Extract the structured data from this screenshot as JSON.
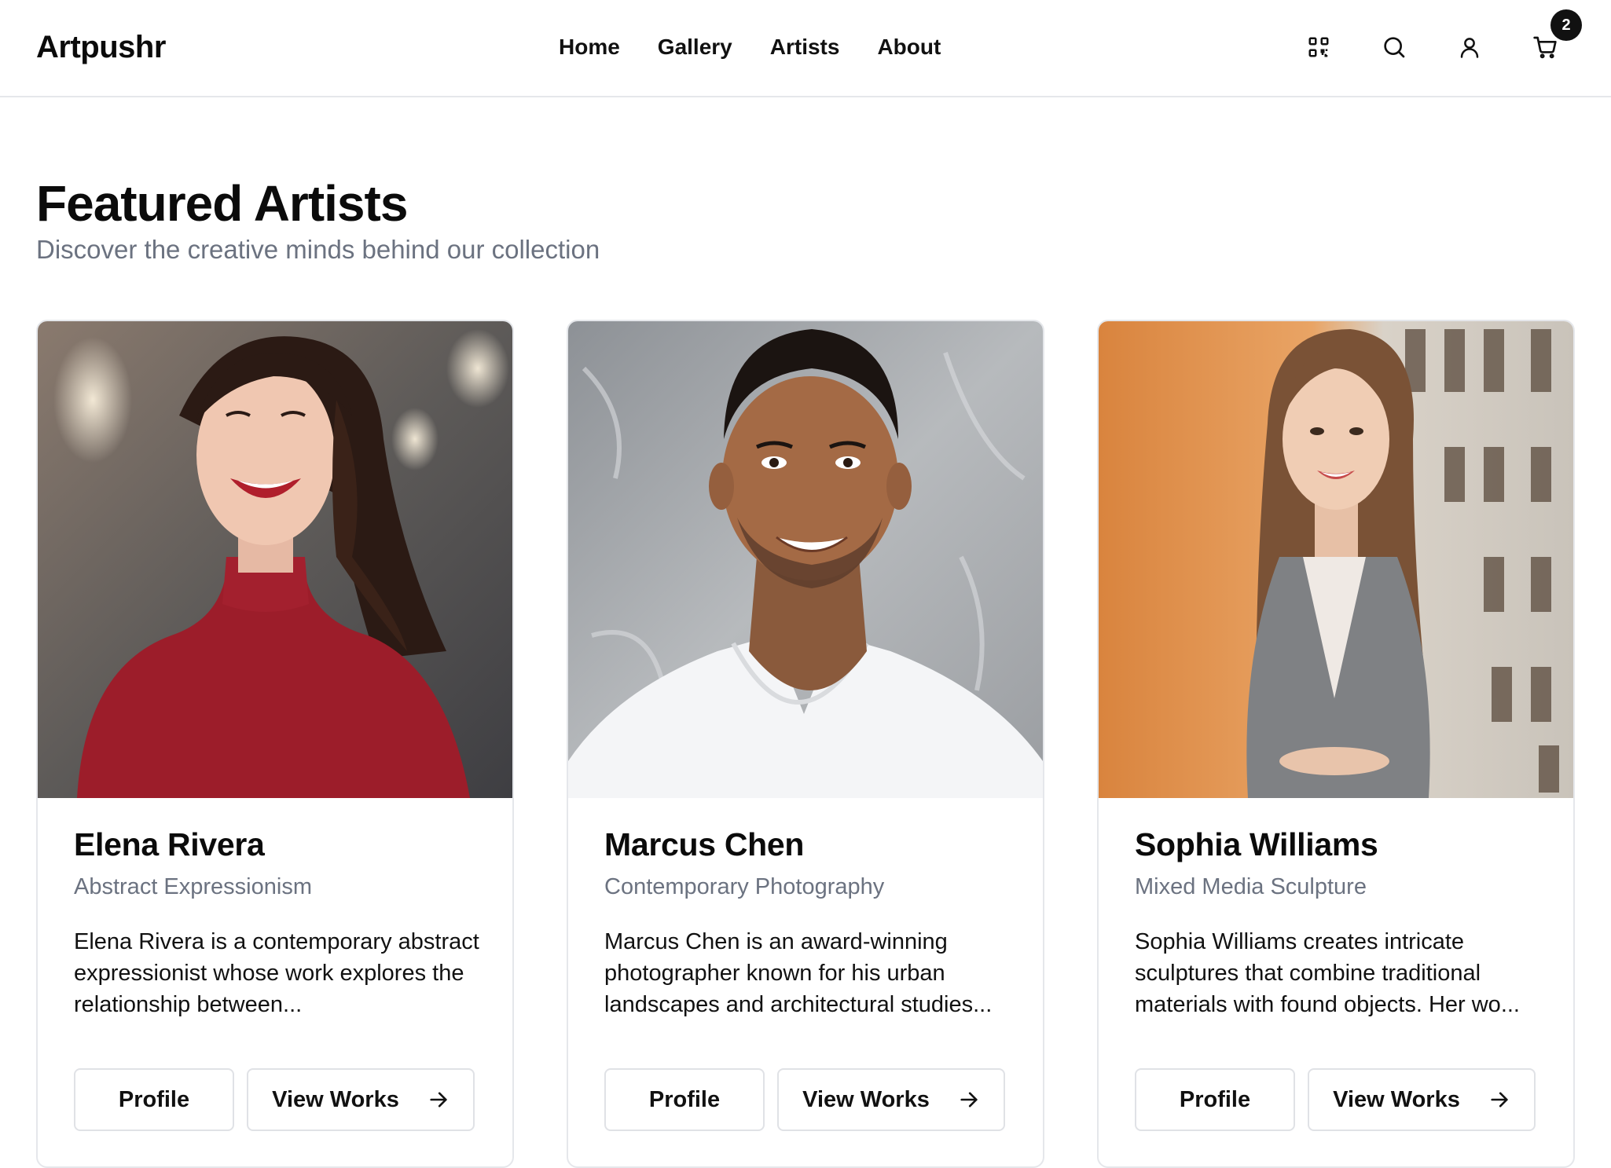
{
  "header": {
    "logo": "Artpushr",
    "nav": [
      {
        "label": "Home"
      },
      {
        "label": "Gallery"
      },
      {
        "label": "Artists"
      },
      {
        "label": "About"
      }
    ],
    "icons": [
      "qr-code-icon",
      "search-icon",
      "user-icon",
      "cart-icon"
    ],
    "cart_count": "2"
  },
  "section": {
    "title": "Featured Artists",
    "subtitle": "Discover the creative minds behind our collection"
  },
  "artists": [
    {
      "name": "Elena Rivera",
      "style": "Abstract Expressionism",
      "bio": "Elena Rivera is a contemporary abstract expressionist whose work explores the relationship between...",
      "profile_label": "Profile",
      "works_label": "View Works"
    },
    {
      "name": "Marcus Chen",
      "style": "Contemporary Photography",
      "bio": "Marcus Chen is an award-winning photographer known for his urban landscapes and architectural studies...",
      "profile_label": "Profile",
      "works_label": "View Works"
    },
    {
      "name": "Sophia Williams",
      "style": "Mixed Media Sculpture",
      "bio": "Sophia Williams creates intricate sculptures that combine traditional materials with found objects. Her wo...",
      "profile_label": "Profile",
      "works_label": "View Works"
    }
  ],
  "colors": {
    "text": "#0b0b0b",
    "muted": "#6b7280",
    "border": "#e5e7eb",
    "badge": "#111111"
  }
}
